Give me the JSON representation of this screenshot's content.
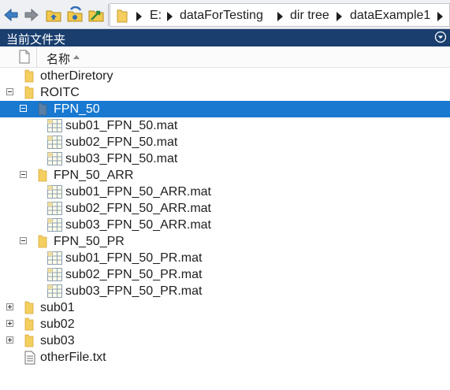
{
  "toolbar": {
    "back_icon": "back-arrow-icon",
    "forward_icon": "forward-arrow-icon",
    "up_icon": "up-folder-icon",
    "browse_icon": "browse-folder-icon",
    "set_path_icon": "set-path-icon"
  },
  "address": {
    "folder_icon": "folder-icon",
    "segments": [
      "E:",
      "dataForTesting",
      "dir tree",
      "dataExample1"
    ]
  },
  "panel": {
    "title": "当前文件夹",
    "menu_icon": "panel-menu-icon"
  },
  "columns": {
    "name": "名称",
    "sort": "ascending"
  },
  "colors": {
    "header_bg": "#1a3f6f",
    "selection": "#1979d1",
    "folder": "#f4cf60"
  },
  "tree": [
    {
      "label": "otherDiretory",
      "type": "folder",
      "level": 0,
      "expander": "none"
    },
    {
      "label": "ROITC",
      "type": "folder",
      "level": 0,
      "expander": "collapse"
    },
    {
      "label": "FPN_50",
      "type": "folder",
      "level": 1,
      "expander": "collapse",
      "selected": true
    },
    {
      "label": "sub01_FPN_50.mat",
      "type": "mat",
      "level": 2,
      "expander": "none"
    },
    {
      "label": "sub02_FPN_50.mat",
      "type": "mat",
      "level": 2,
      "expander": "none"
    },
    {
      "label": "sub03_FPN_50.mat",
      "type": "mat",
      "level": 2,
      "expander": "none"
    },
    {
      "label": "FPN_50_ARR",
      "type": "folder",
      "level": 1,
      "expander": "collapse"
    },
    {
      "label": "sub01_FPN_50_ARR.mat",
      "type": "mat",
      "level": 2,
      "expander": "none"
    },
    {
      "label": "sub02_FPN_50_ARR.mat",
      "type": "mat",
      "level": 2,
      "expander": "none"
    },
    {
      "label": "sub03_FPN_50_ARR.mat",
      "type": "mat",
      "level": 2,
      "expander": "none"
    },
    {
      "label": "FPN_50_PR",
      "type": "folder",
      "level": 1,
      "expander": "collapse"
    },
    {
      "label": "sub01_FPN_50_PR.mat",
      "type": "mat",
      "level": 2,
      "expander": "none"
    },
    {
      "label": "sub02_FPN_50_PR.mat",
      "type": "mat",
      "level": 2,
      "expander": "none"
    },
    {
      "label": "sub03_FPN_50_PR.mat",
      "type": "mat",
      "level": 2,
      "expander": "none"
    },
    {
      "label": "sub01",
      "type": "folder",
      "level": 0,
      "expander": "expand"
    },
    {
      "label": "sub02",
      "type": "folder",
      "level": 0,
      "expander": "expand"
    },
    {
      "label": "sub03",
      "type": "folder",
      "level": 0,
      "expander": "expand"
    },
    {
      "label": "otherFile.txt",
      "type": "txt",
      "level": 0,
      "expander": "none"
    }
  ]
}
